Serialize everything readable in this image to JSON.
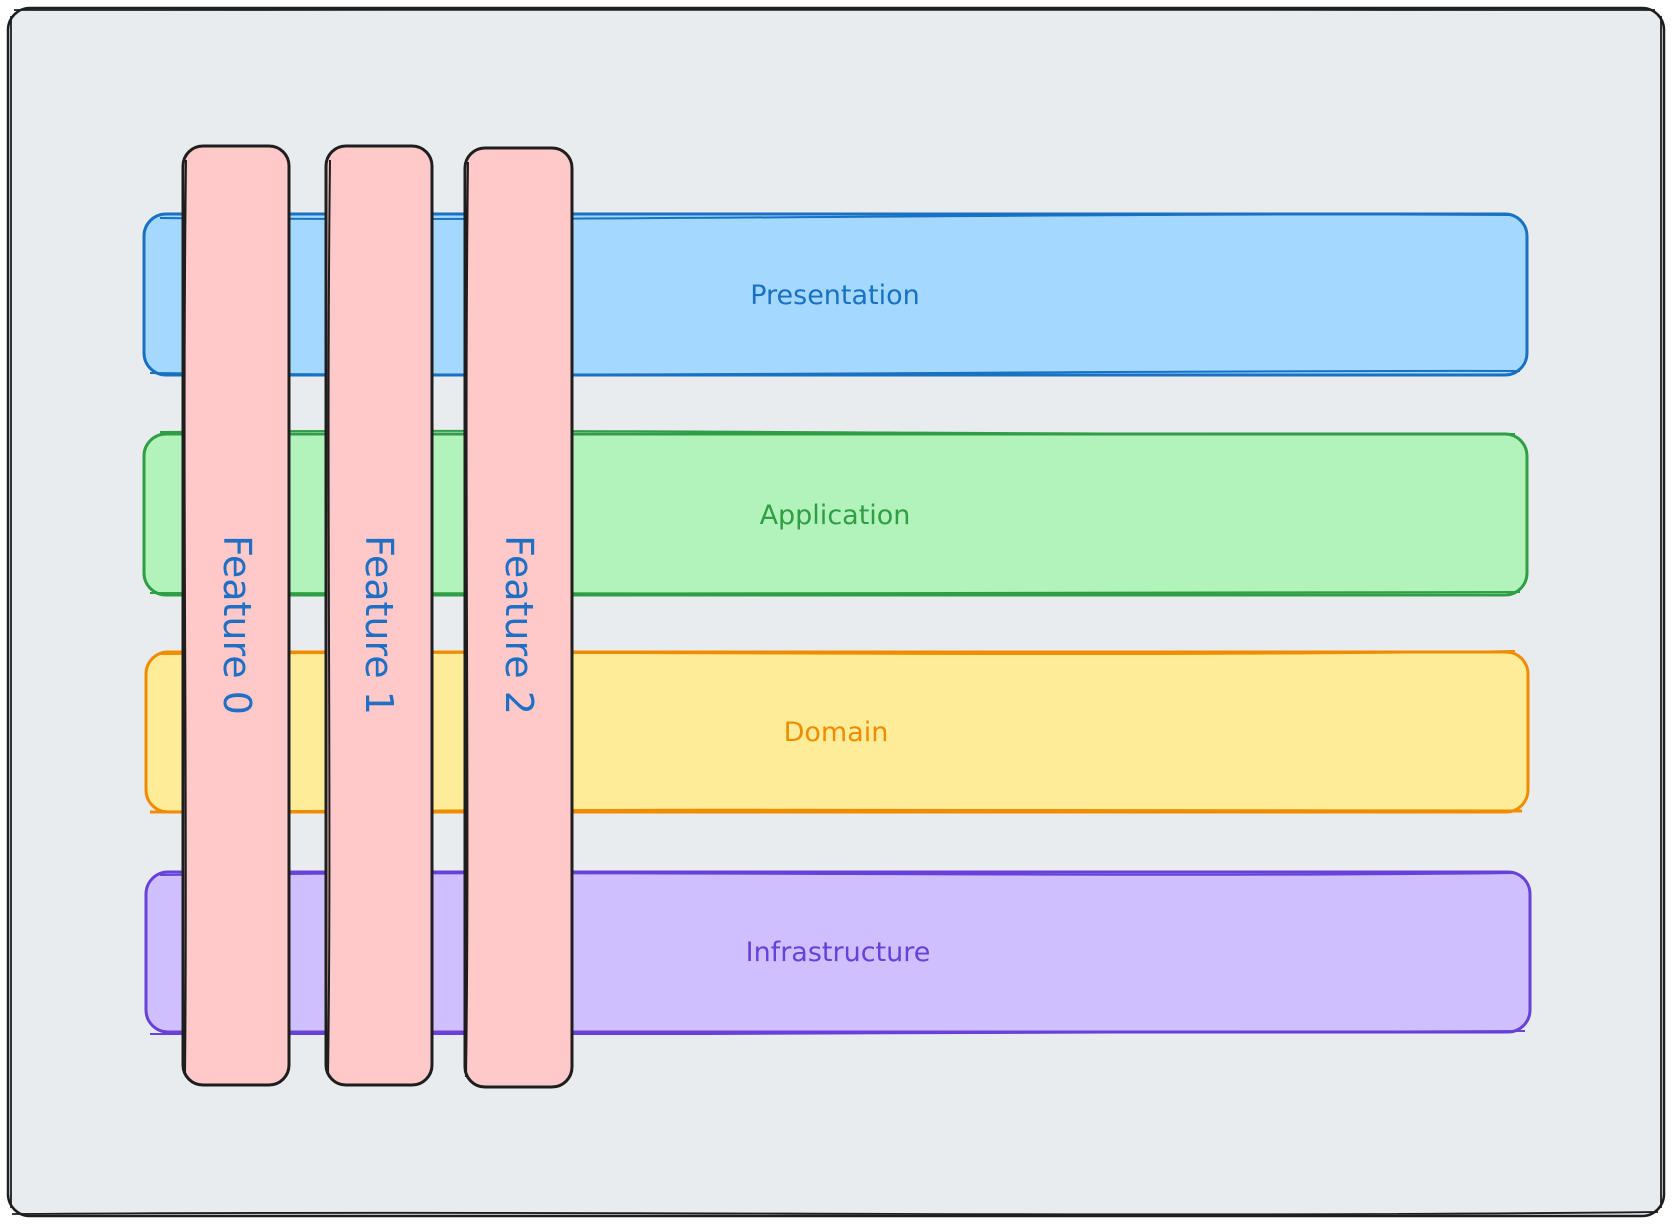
{
  "diagram": {
    "layers": [
      {
        "label": "Presentation",
        "fill": "#a5d8ff",
        "stroke": "#1971c2"
      },
      {
        "label": "Application",
        "fill": "#b2f2bb",
        "stroke": "#2f9e44"
      },
      {
        "label": "Domain",
        "fill": "#ffec99",
        "stroke": "#f08c00"
      },
      {
        "label": "Infrastructure",
        "fill": "#d0bfff",
        "stroke": "#6741d9"
      }
    ],
    "features": [
      {
        "label": "Feature 0"
      },
      {
        "label": "Feature 1"
      },
      {
        "label": "Feature 2"
      }
    ],
    "colors": {
      "background": "#e9ecef",
      "frame_stroke": "#1e1e1e",
      "feature_fill": "#ffc9c9",
      "feature_stroke": "#1e1e1e",
      "feature_text": "#1971c2"
    }
  }
}
